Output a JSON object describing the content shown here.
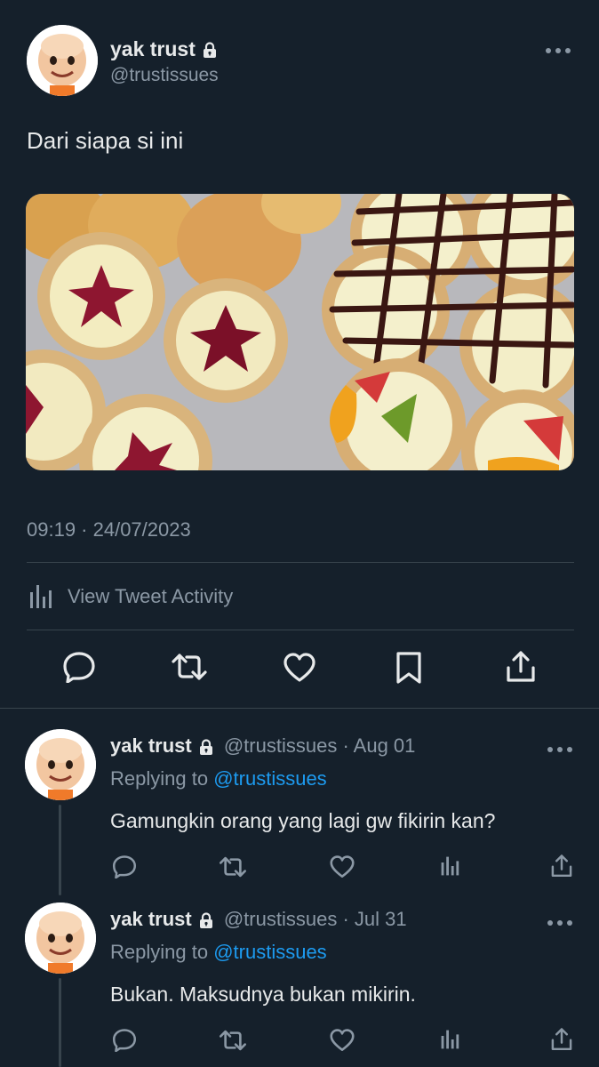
{
  "tweet": {
    "display_name": "yak trust",
    "handle": "@trustissues",
    "text": "Dari siapa si ini",
    "timestamp": "09:19 · 24/07/2023",
    "activity_label": "View Tweet Activity",
    "media_description": "photo of assorted fruit, chocolate and jam tarts with cream puffs"
  },
  "replies": [
    {
      "display_name": "yak trust",
      "handle": "@trustissues",
      "date": "· Aug 01",
      "replying_label": "Replying to",
      "replying_handle": "@trustissues",
      "text": "Gamungkin orang yang lagi gw fikirin kan?"
    },
    {
      "display_name": "yak trust",
      "handle": "@trustissues",
      "date": "· Jul 31",
      "replying_label": "Replying to",
      "replying_handle": "@trustissues",
      "text": "Bukan. Maksudnya bukan mikirin."
    }
  ],
  "icons": {
    "more": "more-horizontal-icon",
    "lock": "lock-icon",
    "reply": "reply-icon",
    "retweet": "retweet-icon",
    "like": "heart-icon",
    "bookmark": "bookmark-icon",
    "share": "share-icon",
    "analytics": "analytics-icon"
  },
  "colors": {
    "background": "#15202b",
    "text": "#e7e9ea",
    "muted": "#8b98a5",
    "link": "#1d9bf0",
    "divider": "#38444d"
  }
}
